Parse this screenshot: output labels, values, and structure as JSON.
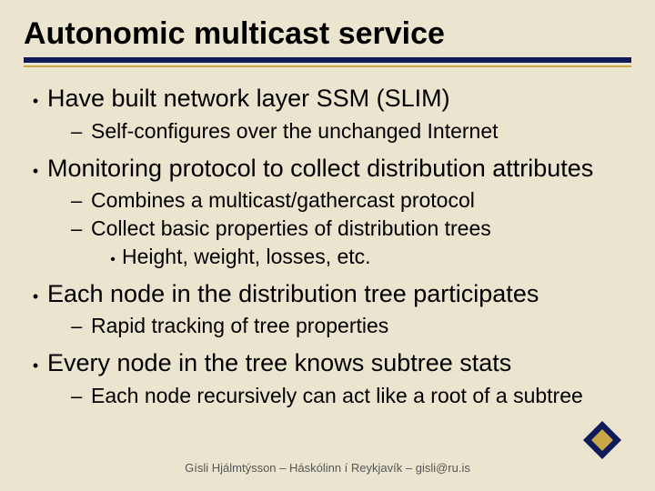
{
  "title": "Autonomic multicast service",
  "bullets": [
    {
      "text": "Have built network layer SSM (SLIM)",
      "sub": [
        {
          "text": "Self-configures over the unchanged Internet"
        }
      ]
    },
    {
      "text": "Monitoring protocol to collect distribution attributes",
      "sub": [
        {
          "text": "Combines a multicast/gathercast protocol"
        },
        {
          "text": "Collect basic properties of distribution trees",
          "sub": [
            {
              "text": "Height, weight, losses, etc."
            }
          ]
        }
      ]
    },
    {
      "text": "Each node in the distribution tree participates",
      "sub": [
        {
          "text": "Rapid tracking of tree properties"
        }
      ]
    },
    {
      "text": "Every node in the tree knows subtree stats",
      "sub": [
        {
          "text": "Each node recursively can act like a root of a subtree"
        }
      ]
    }
  ],
  "footer": "Gísli Hjálmtýsson – Háskólinn í Reykjavík – gisli@ru.is",
  "colors": {
    "background": "#ebe5cf",
    "ruleThick": "#0f1a5a",
    "ruleThin": "#c9a64a",
    "logoDark": "#0f1a5a",
    "logoGold": "#c9a64a"
  }
}
